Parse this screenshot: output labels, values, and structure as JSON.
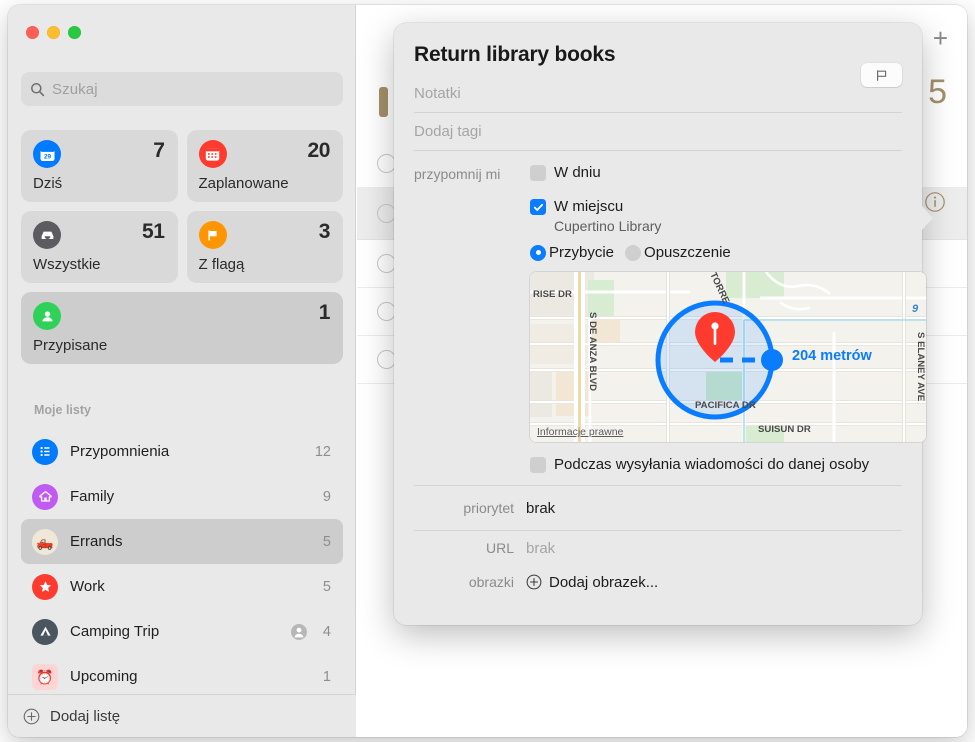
{
  "window": {
    "traffic_lights": [
      "close",
      "minimize",
      "zoom"
    ]
  },
  "sidebar": {
    "search": {
      "placeholder": "Szukaj",
      "value": "",
      "icon": "search-icon"
    },
    "smart_lists": [
      {
        "id": "today",
        "title": "Dziś",
        "count": "7",
        "icon": "calendar-day-icon",
        "icon_color": "#007aff",
        "icon_glyph": "29",
        "selected": false
      },
      {
        "id": "scheduled",
        "title": "Zaplanowane",
        "count": "20",
        "icon": "calendar-icon",
        "icon_color": "#ff3b30",
        "selected": false
      },
      {
        "id": "all",
        "title": "Wszystkie",
        "count": "51",
        "icon": "inbox-tray-icon",
        "icon_color": "#5b5b60",
        "selected": false
      },
      {
        "id": "flagged",
        "title": "Z flagą",
        "count": "3",
        "icon": "flag-icon",
        "icon_color": "#ff9500",
        "selected": false
      },
      {
        "id": "assigned",
        "title": "Przypisane",
        "count": "1",
        "icon": "person-icon",
        "icon_color": "#30d158",
        "selected": true
      }
    ],
    "section_label": "Moje listy",
    "lists": [
      {
        "name": "Przypomnienia",
        "count": "12",
        "icon": "bulleted-list-icon",
        "icon_color": "#007aff",
        "shared": false,
        "selected": false
      },
      {
        "name": "Family",
        "count": "9",
        "icon": "house-icon",
        "icon_color": "#bf5af2",
        "shared": false,
        "selected": false
      },
      {
        "name": "Errands",
        "count": "5",
        "icon": "pickup-truck-emoji",
        "icon_color": "#efe7d8",
        "shared": false,
        "selected": true
      },
      {
        "name": "Work",
        "count": "5",
        "icon": "star-icon",
        "icon_color": "#ff3b30",
        "shared": false,
        "selected": false
      },
      {
        "name": "Camping Trip",
        "count": "4",
        "icon": "tent-icon",
        "icon_color": "#4a5560",
        "shared": true,
        "selected": false
      },
      {
        "name": "Upcoming",
        "count": "1",
        "icon": "alarm-clock-emoji",
        "icon_color": "#ffd4d4",
        "shared": false,
        "selected": false
      }
    ],
    "add_list": {
      "label": "Dodaj listę",
      "icon": "plus-circle-icon"
    }
  },
  "main": {
    "add_reminder_icon": "plus-icon",
    "list_count": "5",
    "accent_color": "#a4916a",
    "info_icon": "info-circle-icon",
    "task_rows": 5
  },
  "popover": {
    "title": "Return library books",
    "flag_button_icon": "flag-outline-icon",
    "notes_placeholder": "Notatki",
    "tags_placeholder": "Dodaj tagi",
    "remind_label": "przypomnij mi",
    "on_day": {
      "label": "W dniu",
      "checked": false
    },
    "at_location": {
      "label": "W miejscu",
      "checked": true,
      "value": "Cupertino Library"
    },
    "trigger_options": [
      {
        "label": "Przybycie",
        "selected": true
      },
      {
        "label": "Opuszczenie",
        "selected": false
      }
    ],
    "map": {
      "distance_label": "204 metrów",
      "legal_label": "Informacje prawne",
      "streets": [
        "RISE DR",
        "S DE ANZA BLVD",
        "TORRE AVE",
        "PACIFICA DR",
        "SUISUN DR",
        "S ELANEY AVE"
      ],
      "highway_label": "9",
      "pin_color": "#ff3b30",
      "radius_color": "#0a7cff"
    },
    "when_messaging": {
      "label": "Podczas wysyłania wiadomości do danej osoby",
      "checked": false
    },
    "priority": {
      "label": "priorytet",
      "value": "brak"
    },
    "url": {
      "label": "URL",
      "value": "brak"
    },
    "images": {
      "label": "obrazki",
      "value": "Dodaj obrazek...",
      "icon": "plus-circle-icon"
    }
  }
}
